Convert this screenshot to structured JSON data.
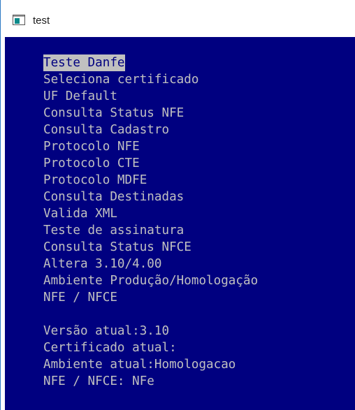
{
  "window": {
    "title": "test",
    "icon": "console-app-icon"
  },
  "colors": {
    "console_background": "#000080",
    "console_text": "#c0c0c0",
    "selection_background": "#c0c0c0",
    "selection_text": "#000080"
  },
  "menu": {
    "items": [
      {
        "label": "Teste Danfe",
        "selected": true
      },
      {
        "label": "Seleciona certificado"
      },
      {
        "label": "UF Default"
      },
      {
        "label": "Consulta Status NFE"
      },
      {
        "label": "Consulta Cadastro"
      },
      {
        "label": "Protocolo NFE"
      },
      {
        "label": "Protocolo CTE"
      },
      {
        "label": "Protocolo MDFE"
      },
      {
        "label": "Consulta Destinadas"
      },
      {
        "label": "Valida XML"
      },
      {
        "label": "Teste de assinatura"
      },
      {
        "label": "Consulta Status NFCE"
      },
      {
        "label": "Altera 3.10/4.00"
      },
      {
        "label": "Ambiente Produção/Homologação"
      },
      {
        "label": "NFE / NFCE"
      }
    ]
  },
  "status": {
    "version": "Versão atual:3.10",
    "certificate": "Certificado atual:",
    "environment": "Ambiente atual:Homologacao",
    "document_type": "NFE / NFCE: NFe"
  }
}
